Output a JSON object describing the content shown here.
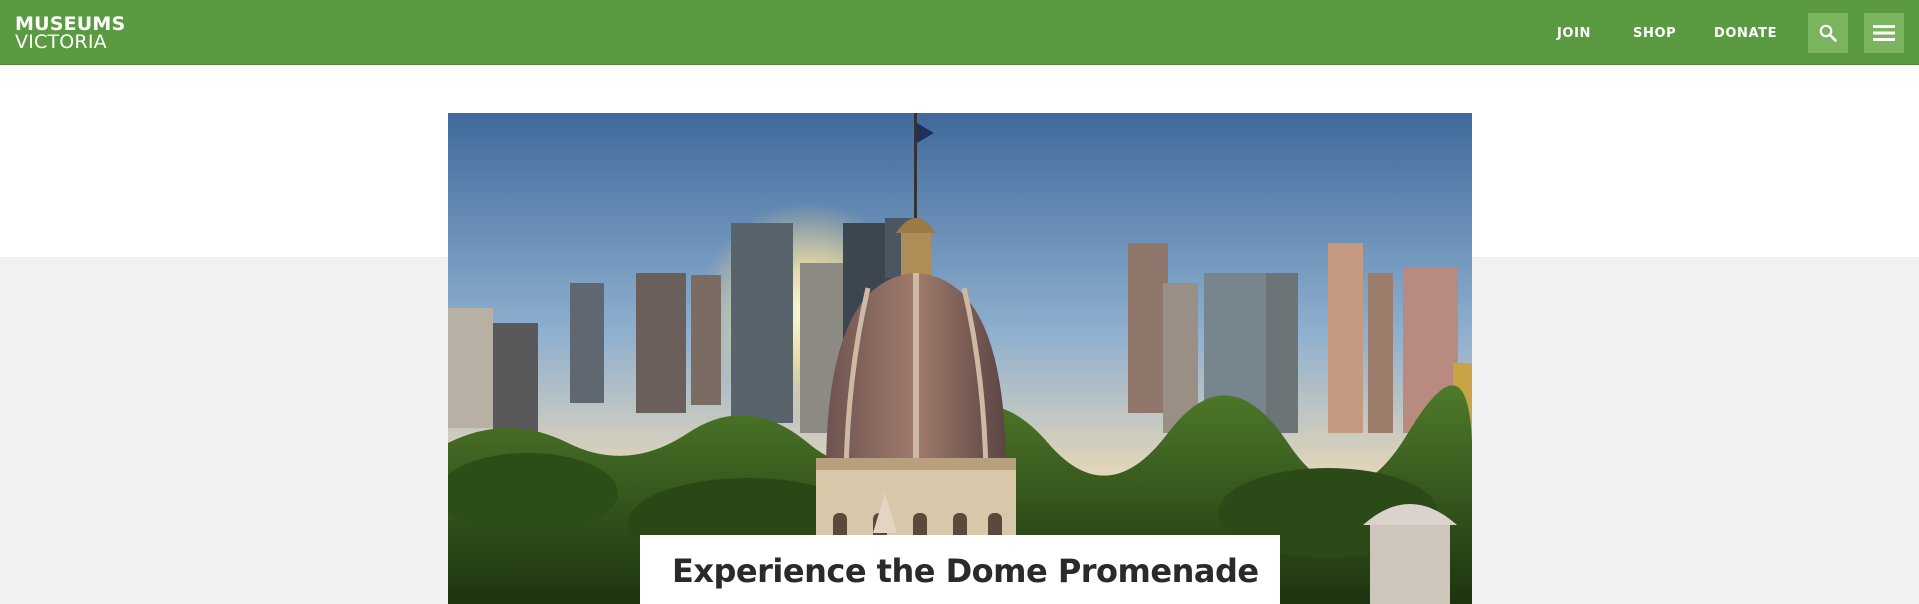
{
  "header": {
    "brand": {
      "line1": "MUSEUMS",
      "line2": "VICTORIA"
    },
    "nav": [
      {
        "label": "JOIN"
      },
      {
        "label": "SHOP"
      },
      {
        "label": "DONATE"
      }
    ],
    "search_icon": "search-icon",
    "menu_icon": "hamburger-menu-icon",
    "color": "#5a9b42",
    "button_color": "#7bb45e"
  },
  "hero": {
    "image": "Royal Exhibition Building dome with Melbourne city skyline at sunrise",
    "caption": "Experience the Dome Promenade"
  }
}
